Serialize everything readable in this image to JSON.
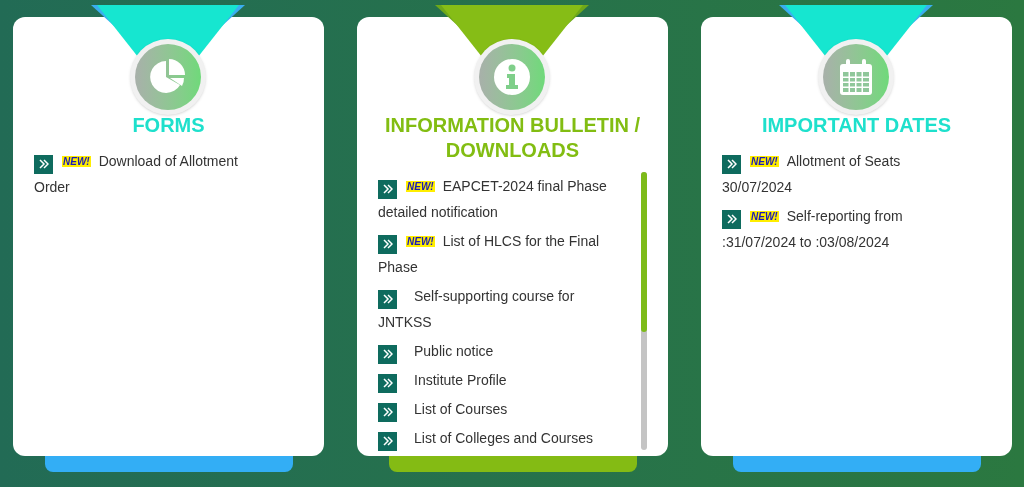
{
  "panels": [
    {
      "kind": "teal",
      "title": "FORMS",
      "items": [
        {
          "badge": "NEW!",
          "text": "Download of Allotment Order"
        }
      ]
    },
    {
      "kind": "lime",
      "title": "INFORMATION BULLETIN / DOWNLOADS",
      "items": [
        {
          "badge": "NEW!",
          "text": "EAPCET-2024 final Phase detailed notification"
        },
        {
          "badge": "NEW!",
          "text": "List of HLCS for the Final Phase"
        },
        {
          "text": "Self-supporting course for JNTKSS"
        },
        {
          "text": "Public notice"
        },
        {
          "text": "Institute Profile"
        },
        {
          "text": "List of Courses"
        },
        {
          "text": "List of Colleges and Courses"
        }
      ]
    },
    {
      "kind": "teal",
      "title": "IMPORTANT DATES",
      "items": [
        {
          "badge": "NEW!",
          "text": "Allotment of Seats 30/07/2024"
        },
        {
          "badge": "NEW!",
          "text": "Self-reporting from :31/07/2024 to :03/08/2024"
        }
      ]
    }
  ]
}
